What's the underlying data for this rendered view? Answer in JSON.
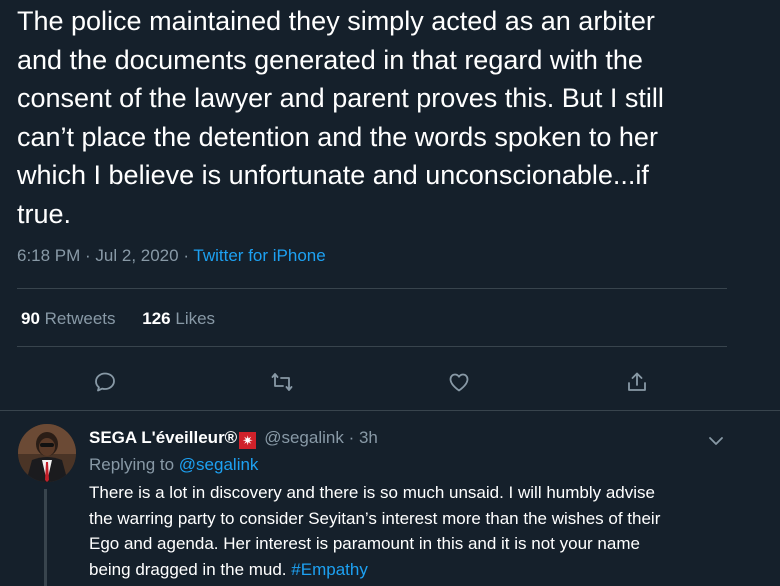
{
  "tweet": {
    "text": "The police maintained they simply acted as an arbiter\nand the documents generated in that regard with the\nconsent of the lawyer and parent proves this. But I still\ncan’t place the detention and the words spoken to her\nwhich I believe is unfortunate and unconscionable...if\ntrue.",
    "time": "6:18 PM · Jul 2, 2020",
    "separator": " · ",
    "source": "Twitter for iPhone",
    "retweets_count": "90",
    "retweets_label": "Retweets",
    "likes_count": "126",
    "likes_label": "Likes"
  },
  "actions": {
    "reply_icon": "reply-icon",
    "retweet_icon": "retweet-icon",
    "like_icon": "like-icon",
    "share_icon": "share-icon"
  },
  "reply": {
    "name": "SEGA L'éveilleur®",
    "badge": "✷",
    "handle": "@segalink",
    "time": "· 3h",
    "replying_label": "Replying to",
    "replying_to": "@segalink",
    "text": "There is a lot in discovery and there is so much unsaid. I will humbly advise\nthe warring party to consider Seyitan’s interest more than the wishes of their\nEgo and agenda. Her interest is paramount in this and it is not your name\nbeing dragged in the mud.",
    "hashtag": "#Empathy"
  },
  "colors": {
    "background": "#15202b",
    "text": "#ffffff",
    "muted": "#8899a6",
    "accent": "#1da1f2",
    "divider": "#38444d",
    "badge": "#d0212a"
  }
}
